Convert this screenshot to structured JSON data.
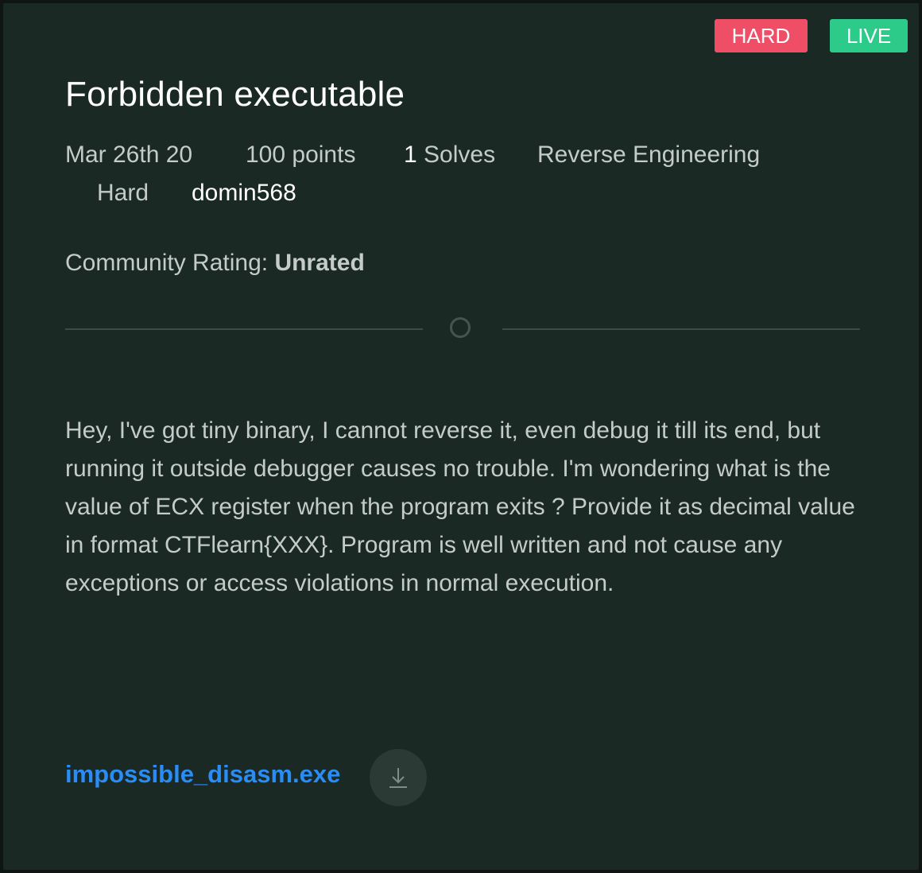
{
  "badges": {
    "difficulty": "HARD",
    "status": "LIVE"
  },
  "challenge": {
    "title": "Forbidden executable",
    "date": "Mar 26th 20",
    "points": "100 points",
    "solves_count": "1",
    "solves_label": " Solves",
    "category": "Reverse Engineering",
    "difficulty": "Hard",
    "author": "domin568",
    "rating_label": "Community Rating: ",
    "rating_value": "Unrated",
    "description": "Hey, I've got tiny binary, I cannot reverse it, even debug it till its end, but running it outside debugger causes no trouble. I'm wondering what is the value of ECX register when the program exits ? Provide it as decimal value in format CTFlearn{XXX}. Program is well written and not cause any exceptions or access violations in normal execution."
  },
  "attachment": {
    "filename": "impossible_disasm.exe",
    "download_icon": "download-icon"
  },
  "colors": {
    "background": "#1a2924",
    "hard_badge": "#ee4f67",
    "live_badge": "#2dcb8a",
    "link": "#2a8cf5",
    "text": "#c4cbc8"
  }
}
